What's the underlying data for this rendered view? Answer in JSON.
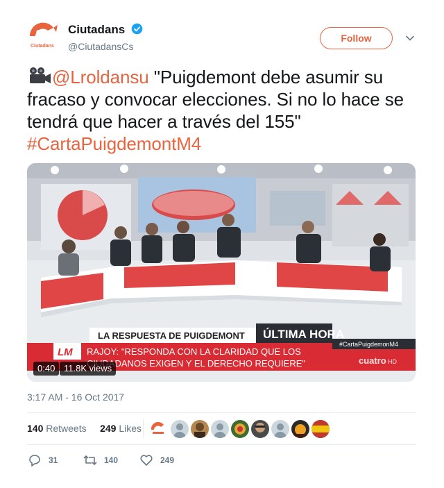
{
  "header": {
    "display_name": "Ciutadans",
    "handle": "@CiutadansCs",
    "follow_label": "Follow",
    "avatar_text": "Cs",
    "avatar_subtext": "Ciutadans"
  },
  "tweet": {
    "camera_icon": "movie-camera-icon",
    "mention": "@Lroldansu",
    "body": " \"Puigdemont debe asumir su fracaso y convocar elecciones. Si no lo hace se tendrá que hacer a través del 155\"",
    "hashtag": "#CartaPuigdemontM4"
  },
  "media": {
    "duration": "0:40",
    "views": "11.8K views",
    "lower_third_headline": "LA RESPUESTA DE PUIGDEMONT",
    "ultima_hora": "ÚLTIMA HORA",
    "quote_line1": "RAJOY: \"RESPONDA CON LA CLARIDAD QUE LOS",
    "quote_line2": "CIUDADANOS EXIGEN Y EL DERECHO REQUIERE\"",
    "hashtag_tag": "#CartaPuigdemonM4",
    "channel": "cuatro",
    "channel_suffix": "HD",
    "logo": "LM"
  },
  "timestamp": "3:17 AM - 16 Oct 2017",
  "stats": {
    "retweets_count": "140",
    "retweets_label": "Retweets",
    "likes_count": "249",
    "likes_label": "Likes"
  },
  "actions": {
    "reply_count": "31",
    "retweet_count": "140",
    "like_count": "249"
  },
  "colors": {
    "accent": "#e8643f",
    "verified": "#1da1f2",
    "muted": "#657786"
  }
}
